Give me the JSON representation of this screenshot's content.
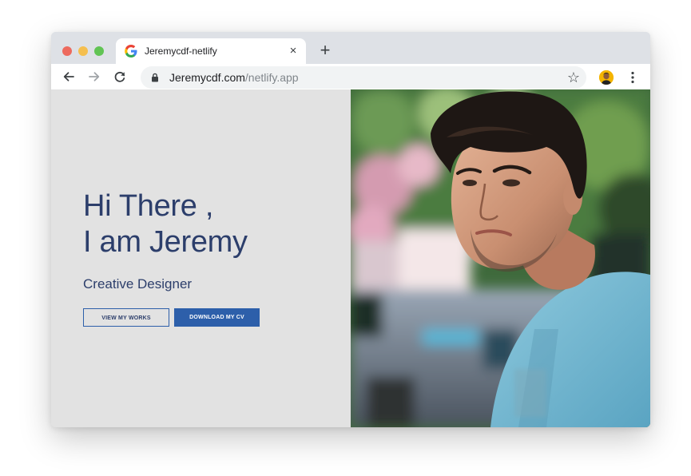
{
  "browser": {
    "tab_title": "Jeremycdf-netlify",
    "tab_close": "×",
    "new_tab": "+",
    "url_host": "Jeremycdf.com",
    "url_path": "/netlify.app",
    "bookmark_star": "☆"
  },
  "hero": {
    "headline_line1": "Hi There ,",
    "headline_line2": "I am Jeremy",
    "subtitle": "Creative Designer",
    "btn_works": "VIEW MY WORKS",
    "btn_cv": "DOWNLOAD MY CV"
  },
  "colors": {
    "heading": "#2c3e6b",
    "primary_button": "#2d5faa",
    "page_background": "#e2e2e2"
  },
  "icons": [
    "google-favicon",
    "close-icon",
    "plus-icon",
    "back-arrow-icon",
    "forward-arrow-icon",
    "reload-icon",
    "lock-icon",
    "star-icon",
    "profile-avatar",
    "kebab-menu-icon"
  ]
}
